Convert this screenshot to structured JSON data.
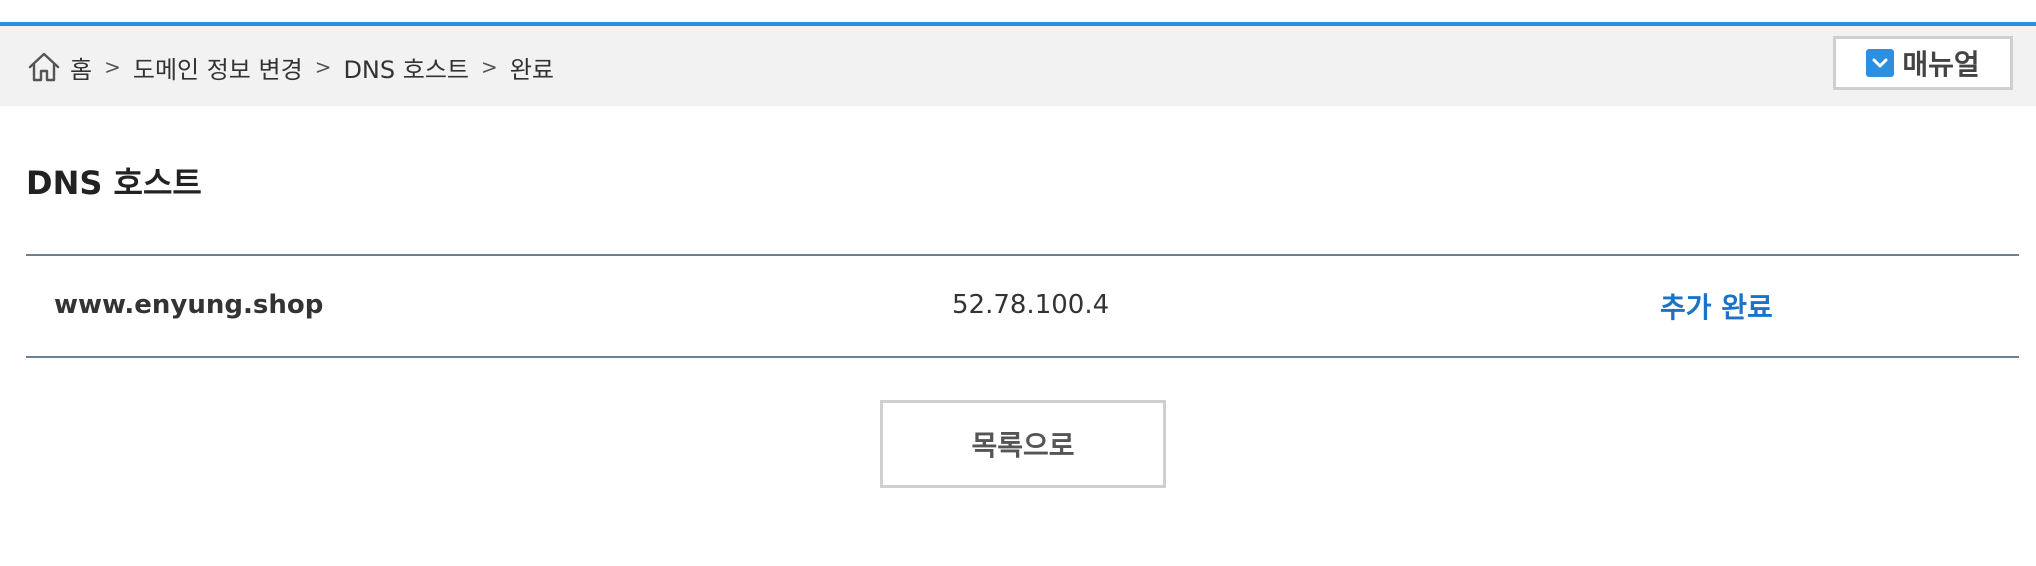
{
  "breadcrumb": {
    "icon": "home-icon",
    "items": [
      "홈",
      "도메인 정보 변경",
      "DNS 호스트",
      "완료"
    ],
    "separator": ">"
  },
  "manual_button": {
    "label": "매뉴얼",
    "icon": "checkbox-chevron-icon",
    "accent": "#2e8fde"
  },
  "page_title": "DNS 호스트",
  "dns_table": {
    "rows": [
      {
        "host": "www.enyung.shop",
        "ip": "52.78.100.4",
        "status": "추가 완료"
      }
    ]
  },
  "list_button": {
    "label": "목록으로"
  },
  "colors": {
    "accent_blue": "#2e8fde",
    "status_blue": "#1a73c8",
    "table_border": "#6b8296"
  }
}
